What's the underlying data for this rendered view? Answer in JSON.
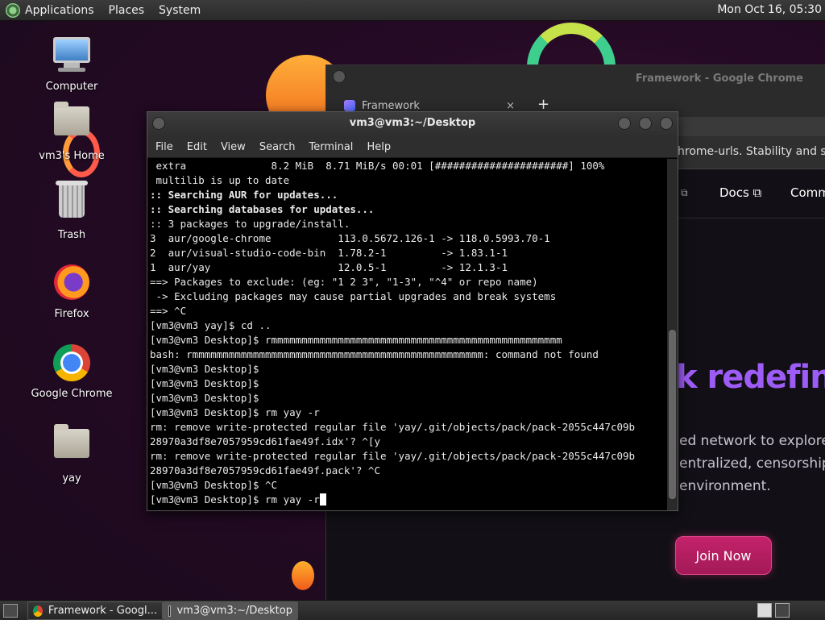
{
  "top_panel": {
    "menus": [
      "Applications",
      "Places",
      "System"
    ],
    "clock": "Mon Oct 16, 05:30"
  },
  "desktop": {
    "icons": [
      {
        "label": "Computer",
        "icon": "computer-icon"
      },
      {
        "label": "vm3's Home",
        "icon": "home-folder-icon"
      },
      {
        "label": "Trash",
        "icon": "trash-icon"
      },
      {
        "label": "Firefox",
        "icon": "firefox-icon"
      },
      {
        "label": "Google Chrome",
        "icon": "chrome-icon"
      },
      {
        "label": "yay",
        "icon": "folder-icon"
      }
    ]
  },
  "chrome_window": {
    "title": "Framework - Google Chrome",
    "tab_label": "Framework",
    "tab_close": "×",
    "new_tab": "+",
    "infobar_text": "hrome-urls. Stability and secu",
    "nav": {
      "ext_icon": "⧉",
      "docs": "Docs ⧉",
      "community": "Comm"
    },
    "hero_title": "k redefin",
    "hero_lines": [
      "ed network to explore t",
      "entralized, censorship-",
      "environment."
    ],
    "join_button": "Join Now"
  },
  "terminal": {
    "title": "vm3@vm3:~/Desktop",
    "menus": [
      "File",
      "Edit",
      "View",
      "Search",
      "Terminal",
      "Help"
    ],
    "lines": [
      {
        "text": " extra              8.2 MiB  8.71 MiB/s 00:01 [######################] 100%",
        "bold": false
      },
      {
        "text": " multilib is up to date",
        "bold": false
      },
      {
        "text": ":: Searching AUR for updates...",
        "bold": true
      },
      {
        "text": ":: Searching databases for updates...",
        "bold": true
      },
      {
        "text": ":: 3 packages to upgrade/install.",
        "bold": false
      },
      {
        "text": "3  aur/google-chrome           113.0.5672.126-1 -> 118.0.5993.70-1",
        "bold": false
      },
      {
        "text": "2  aur/visual-studio-code-bin  1.78.2-1         -> 1.83.1-1",
        "bold": false
      },
      {
        "text": "1  aur/yay                     12.0.5-1         -> 12.1.3-1",
        "bold": false
      },
      {
        "text": "==> Packages to exclude: (eg: \"1 2 3\", \"1-3\", \"^4\" or repo name)",
        "bold": false
      },
      {
        "text": " -> Excluding packages may cause partial upgrades and break systems",
        "bold": false
      },
      {
        "text": "==> ^C",
        "bold": false
      },
      {
        "text": "[vm3@vm3 yay]$ cd ..",
        "bold": false
      },
      {
        "text": "[vm3@vm3 Desktop]$ rmmmmmmmmmmmmmmmmmmmmmmmmmmmmmmmmmmmmmmmmmmmmmmmm",
        "bold": false
      },
      {
        "text": "bash: rmmmmmmmmmmmmmmmmmmmmmmmmmmmmmmmmmmmmmmmmmmmmmmmm: command not found",
        "bold": false
      },
      {
        "text": "[vm3@vm3 Desktop]$",
        "bold": false
      },
      {
        "text": "[vm3@vm3 Desktop]$",
        "bold": false
      },
      {
        "text": "[vm3@vm3 Desktop]$",
        "bold": false
      },
      {
        "text": "[vm3@vm3 Desktop]$ rm yay -r",
        "bold": false
      },
      {
        "text": "rm: remove write-protected regular file 'yay/.git/objects/pack/pack-2055c447c09b",
        "bold": false
      },
      {
        "text": "28970a3df8e7057959cd61fae49f.idx'? ^[y",
        "bold": false
      },
      {
        "text": "rm: remove write-protected regular file 'yay/.git/objects/pack/pack-2055c447c09b",
        "bold": false
      },
      {
        "text": "28970a3df8e7057959cd61fae49f.pack'? ^C",
        "bold": false
      },
      {
        "text": "[vm3@vm3 Desktop]$ ^C",
        "bold": false
      }
    ],
    "prompt_line": "[vm3@vm3 Desktop]$ rm yay -r"
  },
  "taskbar": {
    "tasks": [
      {
        "label": "Framework - Googl...",
        "icon": "chrome-icon",
        "active": false
      },
      {
        "label": "vm3@vm3:~/Desktop",
        "icon": "terminal-icon",
        "active": true
      }
    ]
  }
}
